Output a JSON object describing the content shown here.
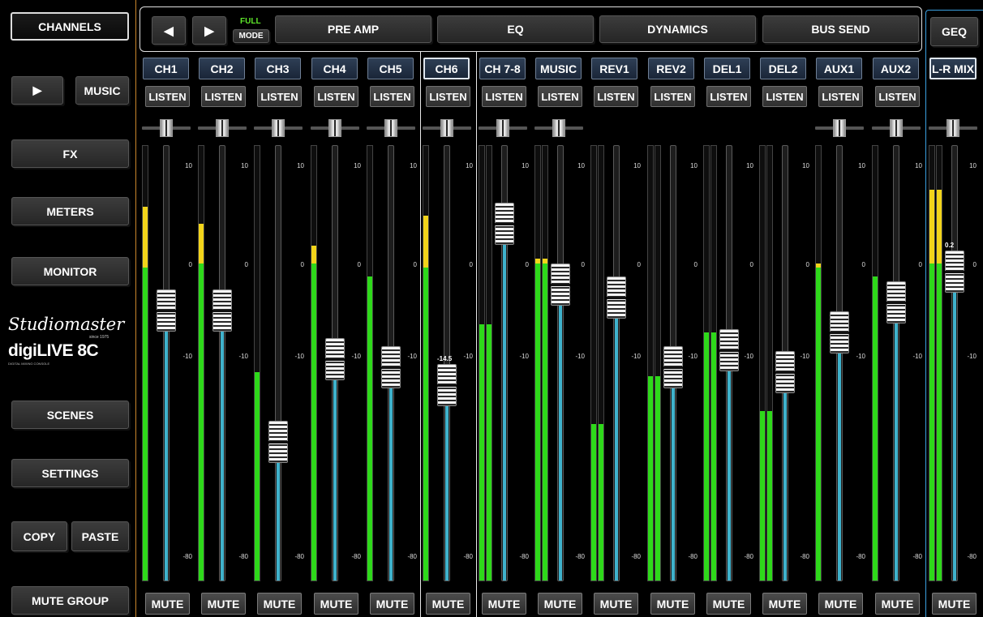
{
  "sidebar": {
    "channels": "CHANNELS",
    "play_icon": "play-icon",
    "music": "MUSIC",
    "fx": "FX",
    "meters": "METERS",
    "monitor": "MONITOR",
    "scenes": "SCENES",
    "settings": "SETTINGS",
    "copy": "COPY",
    "paste": "PASTE",
    "mute_group": "MUTE GROUP"
  },
  "logo": {
    "brand": "Studiomaster",
    "tagline": "since 1975",
    "product": "digiLIVE 8C",
    "sub": "DIGITAL MIXING CONSOLE"
  },
  "topbar": {
    "prev_icon": "chevron-left-icon",
    "next_icon": "chevron-right-icon",
    "full": "FULL",
    "mode": "MODE",
    "tabs": [
      "PRE AMP",
      "EQ",
      "DYNAMICS",
      "BUS SEND"
    ],
    "geq": "GEQ"
  },
  "channels": [
    {
      "name": "CH1",
      "listen": "LISTEN",
      "mute": "MUTE",
      "fader": 0.62,
      "meter": 0.72,
      "peak": 0.86
    },
    {
      "name": "CH2",
      "listen": "LISTEN",
      "mute": "MUTE",
      "fader": 0.62,
      "meter": 0.73,
      "peak": 0.82
    },
    {
      "name": "CH3",
      "listen": "LISTEN",
      "mute": "MUTE",
      "fader": 0.32,
      "meter": 0.48,
      "peak": 0.48
    },
    {
      "name": "CH4",
      "listen": "LISTEN",
      "mute": "MUTE",
      "fader": 0.51,
      "meter": 0.73,
      "peak": 0.77
    },
    {
      "name": "CH5",
      "listen": "LISTEN",
      "mute": "MUTE",
      "fader": 0.49,
      "meter": 0.7,
      "peak": 0.7
    },
    {
      "name": "CH6",
      "listen": "LISTEN",
      "mute": "MUTE",
      "fader": 0.45,
      "meter": 0.72,
      "peak": 0.84,
      "value": "-14.5",
      "selected": true
    },
    {
      "name": "CH 7-8",
      "listen": "LISTEN",
      "mute": "MUTE",
      "fader": 0.82,
      "meter": 0.59,
      "peak": 0.59
    },
    {
      "name": "MUSIC",
      "listen": "LISTEN",
      "mute": "MUTE",
      "fader": 0.68,
      "meter": 0.73,
      "peak": 0.74
    },
    {
      "name": "REV1",
      "listen": "LISTEN",
      "mute": "MUTE",
      "fader": 0.65,
      "meter": 0.36,
      "peak": 0.36
    },
    {
      "name": "REV2",
      "listen": "LISTEN",
      "mute": "MUTE",
      "fader": 0.49,
      "meter": 0.47,
      "peak": 0.47
    },
    {
      "name": "DEL1",
      "listen": "LISTEN",
      "mute": "MUTE",
      "fader": 0.53,
      "meter": 0.57,
      "peak": 0.57
    },
    {
      "name": "DEL2",
      "listen": "LISTEN",
      "mute": "MUTE",
      "fader": 0.48,
      "meter": 0.39,
      "peak": 0.39
    },
    {
      "name": "AUX1",
      "listen": "LISTEN",
      "mute": "MUTE",
      "fader": 0.57,
      "meter": 0.72,
      "peak": 0.73
    },
    {
      "name": "AUX2",
      "listen": "LISTEN",
      "mute": "MUTE",
      "fader": 0.64,
      "meter": 0.7,
      "peak": 0.7
    },
    {
      "name": "L-R MIX",
      "listen": "",
      "mute": "MUTE",
      "fader": 0.71,
      "meter": 0.73,
      "peak": 0.9,
      "value": "0.2",
      "selected": true,
      "master": true
    }
  ],
  "scale_labels": [
    "10",
    "0",
    "-10",
    "-80"
  ],
  "colors": {
    "meter_green": "#2ed91a",
    "meter_yellow": "#f2d41a",
    "fader_fill": "#3fb2cc",
    "accent_orange": "#d08a2a",
    "accent_blue": "#3aa0e0"
  }
}
